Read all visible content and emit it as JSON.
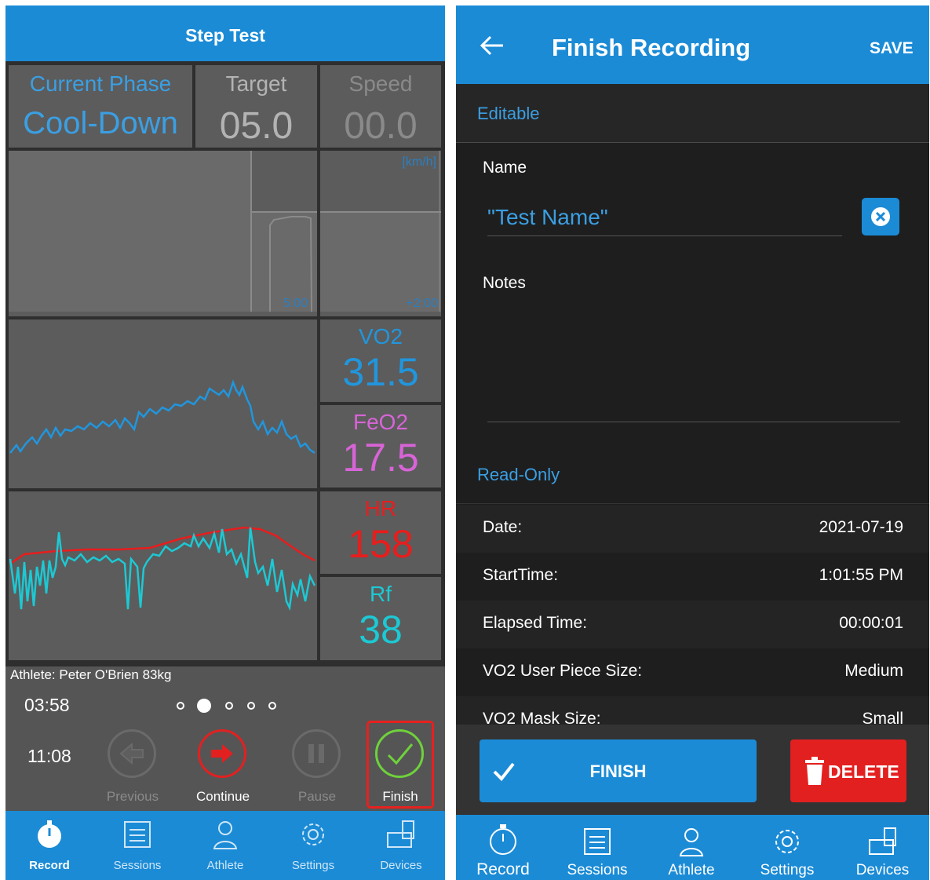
{
  "left": {
    "header_title": "Step Test",
    "current_phase": {
      "label": "Current Phase",
      "value": "Cool-Down"
    },
    "target": {
      "label": "Target",
      "value": "05.0"
    },
    "speed": {
      "label": "Speed",
      "value": "00.0"
    },
    "speed_unit": "[km/h]",
    "phase_time": "5:00",
    "speed_time": "+2:00",
    "metrics": [
      {
        "label": "VO2",
        "value": "31.5",
        "color": "#2196dd"
      },
      {
        "label": "FeO2",
        "value": "17.5",
        "color": "#d864d8"
      },
      {
        "label": "HR",
        "value": "158",
        "color": "#e81d1d"
      },
      {
        "label": "Rf",
        "value": "38",
        "color": "#1cc9d4"
      }
    ],
    "athlete": "Athlete: Peter O'Brien 83kg",
    "elapsed": "03:58",
    "clock": "11:08",
    "pager": {
      "count": 5,
      "active": 1
    },
    "controls": [
      {
        "label": "Previous",
        "icon": "arrow-left-icon",
        "enabled": false
      },
      {
        "label": "Continue",
        "icon": "arrow-right-icon",
        "enabled": true
      },
      {
        "label": "Pause",
        "icon": "pause-icon",
        "enabled": false
      },
      {
        "label": "Finish",
        "icon": "check-circle-icon",
        "enabled": true
      }
    ],
    "tabs": [
      {
        "label": "Record",
        "icon": "stopwatch-icon",
        "active": true
      },
      {
        "label": "Sessions",
        "icon": "list-icon",
        "active": false
      },
      {
        "label": "Athlete",
        "icon": "person-icon",
        "active": false
      },
      {
        "label": "Settings",
        "icon": "gear-icon",
        "active": false
      },
      {
        "label": "Devices",
        "icon": "devices-icon",
        "active": false
      }
    ]
  },
  "right": {
    "header_title": "Finish Recording",
    "save_label": "SAVE",
    "editable_label": "Editable",
    "name_label": "Name",
    "name_value": "\"Test Name\"",
    "notes_label": "Notes",
    "readonly_label": "Read-Only",
    "rows": [
      {
        "label": "Date:",
        "value": "2021-07-19"
      },
      {
        "label": "StartTime:",
        "value": "1:01:55 PM"
      },
      {
        "label": "Elapsed Time:",
        "value": "00:00:01"
      },
      {
        "label": "VO2 User Piece Size:",
        "value": "Medium"
      },
      {
        "label": "VO2 Mask Size:",
        "value": "Small"
      }
    ],
    "finish_label": "FINISH",
    "delete_label": "DELETE",
    "tabs": [
      {
        "label": "Record",
        "icon": "stopwatch-icon"
      },
      {
        "label": "Sessions",
        "icon": "list-icon"
      },
      {
        "label": "Athlete",
        "icon": "person-icon"
      },
      {
        "label": "Settings",
        "icon": "gear-icon"
      },
      {
        "label": "Devices",
        "icon": "devices-icon"
      }
    ]
  },
  "colors": {
    "accent": "#1b8bd6",
    "delete": "#e32020",
    "finish_highlight": "#e8201e",
    "check_green": "#6fd13c"
  }
}
